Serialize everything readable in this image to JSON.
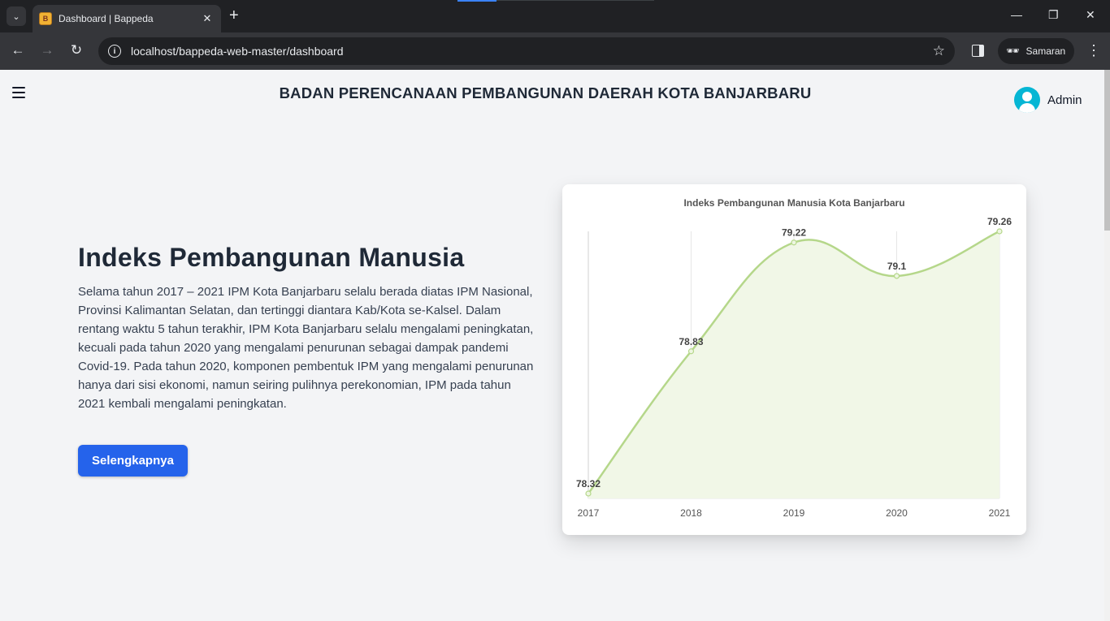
{
  "browser": {
    "tab_title": "Dashboard | Bappeda",
    "url": "localhost/bappeda-web-master/dashboard",
    "profile_label": "Samaran"
  },
  "header": {
    "site_title": "BADAN PERENCANAAN PEMBANGUNAN DAERAH KOTA BANJARBARU",
    "user_name": "Admin"
  },
  "hero": {
    "title": "Indeks Pembangunan Manusia",
    "description": "Selama tahun 2017 – 2021 IPM Kota Banjarbaru selalu berada diatas IPM Nasional, Provinsi Kalimantan Selatan, dan tertinggi diantara Kab/Kota se-Kalsel. Dalam rentang waktu 5 tahun terakhir, IPM Kota Banjarbaru selalu mengalami peningkatan, kecuali pada tahun 2020 yang mengalami penurunan sebagai dampak pandemi Covid-19. Pada tahun 2020, komponen pembentuk IPM yang mengalami penurunan hanya dari sisi ekonomi, namun seiring pulihnya perekonomian, IPM pada tahun 2021 kembali mengalami peningkatan.",
    "button_label": "Selengkapnya"
  },
  "colors": {
    "accent_button": "#2563eb",
    "avatar": "#06b6d4",
    "line": "#b5d78a",
    "fill": "#f1f7e7"
  },
  "chart_data": {
    "type": "area",
    "title": "Indeks Pembangunan Manusia Kota Banjarbaru",
    "categories": [
      "2017",
      "2018",
      "2019",
      "2020",
      "2021"
    ],
    "values": [
      78.32,
      78.83,
      79.22,
      79.1,
      79.26
    ],
    "data_labels": [
      "78.32",
      "78.83",
      "79.22",
      "79.1",
      "79.26"
    ],
    "ylim": [
      78.32,
      79.26
    ],
    "grid": "vertical",
    "legend": "none"
  }
}
